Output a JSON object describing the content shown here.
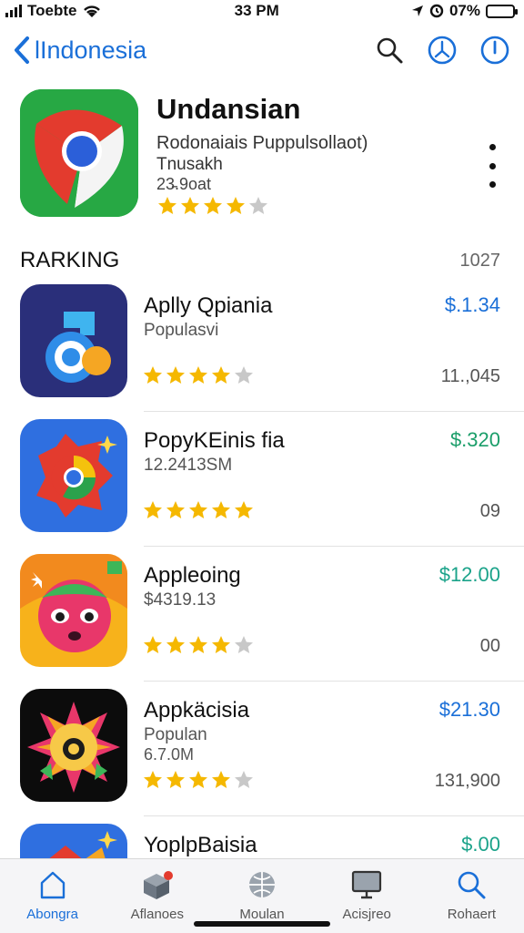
{
  "status": {
    "carrier": "Toebte",
    "time": "33 PM",
    "battery": "07%"
  },
  "nav": {
    "back_label": "lIndonesia"
  },
  "featured": {
    "title": "Undansian",
    "subtitle": "Rodonaiais Puppulsollaot)",
    "subtitle2": "Tnusakh",
    "count": "23̵.9oat",
    "rating": 4
  },
  "section": {
    "title": "RARKING",
    "count": "1027"
  },
  "apps": [
    {
      "name": "Aplly Qpiania",
      "subtitle": "Populasvi",
      "subtitle2": "",
      "price": "$.1.34",
      "price_color": "#1a6fd8",
      "rank": "11.,045",
      "rating": 4
    },
    {
      "name": "PopyKEinis fia",
      "subtitle": "12.2413SM",
      "subtitle2": "",
      "price": "$.320",
      "price_color": "#1b9e6a",
      "rank": "09",
      "rating": 5
    },
    {
      "name": "Appleoing",
      "subtitle": "$4319.13",
      "subtitle2": "",
      "price": "$12.00",
      "price_color": "#1ba38a",
      "rank": "00",
      "rating": 4
    },
    {
      "name": "Appkäcisia",
      "subtitle": "Populan",
      "subtitle2": "6.7.0M",
      "price": "$21.30",
      "price_color": "#1a6fd8",
      "rank": "131,900",
      "rating": 4
    },
    {
      "name": "YoplpBaisia",
      "subtitle": "",
      "subtitle2": "",
      "price": "$.00",
      "price_color": "#1ba38a",
      "rank": "",
      "rating": 0
    }
  ],
  "tabs": [
    {
      "label": "Abongra",
      "icon": "home-icon",
      "active": true
    },
    {
      "label": "Aflanoes",
      "icon": "box-icon",
      "active": false
    },
    {
      "label": "Moulan",
      "icon": "globe-icon",
      "active": false
    },
    {
      "label": "Acisjreo",
      "icon": "monitor-icon",
      "active": false
    },
    {
      "label": "Rohaert",
      "icon": "search-icon",
      "active": false
    }
  ],
  "colors": {
    "accent": "#1a6fd8",
    "star": "#f5b800",
    "star_empty": "#c8c8c8"
  }
}
